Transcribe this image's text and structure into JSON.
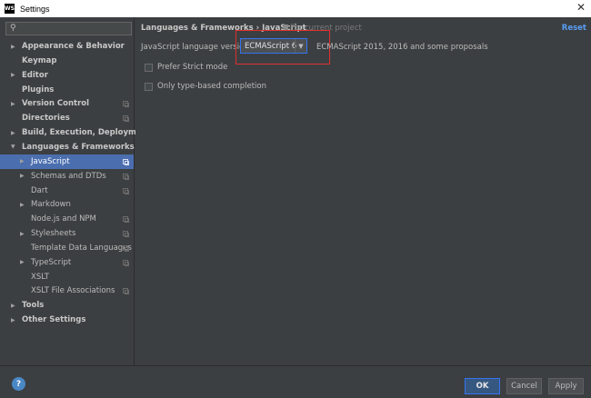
{
  "window": {
    "app_icon": "WS",
    "title": "Settings",
    "close": "✕"
  },
  "search": {
    "placeholder": "",
    "icon": "search-icon"
  },
  "tree": [
    {
      "label": "Appearance & Behavior",
      "bold": true,
      "arrow": "▶",
      "copy": false
    },
    {
      "label": "Keymap",
      "bold": true,
      "arrow": "",
      "copy": false
    },
    {
      "label": "Editor",
      "bold": true,
      "arrow": "▶",
      "copy": false
    },
    {
      "label": "Plugins",
      "bold": true,
      "arrow": "",
      "copy": false
    },
    {
      "label": "Version Control",
      "bold": true,
      "arrow": "▶",
      "copy": true
    },
    {
      "label": "Directories",
      "bold": true,
      "arrow": "",
      "copy": true
    },
    {
      "label": "Build, Execution, Deployment",
      "bold": true,
      "arrow": "▶",
      "copy": false
    },
    {
      "label": "Languages & Frameworks",
      "bold": true,
      "arrow": "▼",
      "copy": false
    },
    {
      "label": "JavaScript",
      "bold": false,
      "arrow": "▶",
      "copy": true,
      "selected": true
    },
    {
      "label": "Schemas and DTDs",
      "bold": false,
      "arrow": "▶",
      "copy": true
    },
    {
      "label": "Dart",
      "bold": false,
      "arrow": "",
      "copy": true
    },
    {
      "label": "Markdown",
      "bold": false,
      "arrow": "▶",
      "copy": false
    },
    {
      "label": "Node.js and NPM",
      "bold": false,
      "arrow": "",
      "copy": true
    },
    {
      "label": "Stylesheets",
      "bold": false,
      "arrow": "▶",
      "copy": true
    },
    {
      "label": "Template Data Languages",
      "bold": false,
      "arrow": "",
      "copy": true
    },
    {
      "label": "TypeScript",
      "bold": false,
      "arrow": "▶",
      "copy": true
    },
    {
      "label": "XSLT",
      "bold": false,
      "arrow": "",
      "copy": false
    },
    {
      "label": "XSLT File Associations",
      "bold": false,
      "arrow": "",
      "copy": true
    },
    {
      "label": "Tools",
      "bold": true,
      "arrow": "▶",
      "copy": false
    },
    {
      "label": "Other Settings",
      "bold": true,
      "arrow": "▶",
      "copy": false
    }
  ],
  "content": {
    "breadcrumb": "Languages & Frameworks › JavaScript",
    "for_project": "For current project",
    "reset": "Reset",
    "lang_label": "JavaScript language version",
    "lang_value": "ECMAScript 6",
    "lang_desc": "ECMAScript 2015, 2016 and some proposals",
    "prefer_strict": "Prefer Strict mode",
    "type_based": "Only type-based completion"
  },
  "footer": {
    "help": "?",
    "ok": "OK",
    "cancel": "Cancel",
    "apply": "Apply"
  },
  "colors": {
    "background": "#3c3f41",
    "selection": "#4b6eaf",
    "accent": "#589df6",
    "highlight_box": "#e03030"
  }
}
